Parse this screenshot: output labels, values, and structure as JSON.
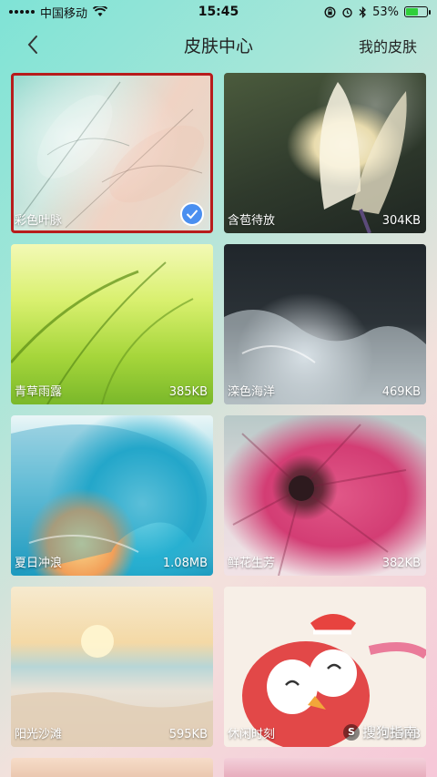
{
  "status_bar": {
    "carrier": "中国移动",
    "time": "15:45",
    "battery_percent": "53%",
    "battery_level": 0.53
  },
  "nav": {
    "title": "皮肤中心",
    "my_skins_label": "我的皮肤"
  },
  "skins": [
    {
      "name": "彩色叶脉",
      "size": "",
      "selected": true
    },
    {
      "name": "含苞待放",
      "size": "304KB"
    },
    {
      "name": "青草雨露",
      "size": "385KB"
    },
    {
      "name": "滦色海洋",
      "size": "469KB"
    },
    {
      "name": "夏日冲浪",
      "size": "1.08MB"
    },
    {
      "name": "鲜花生芳",
      "size": "382KB"
    },
    {
      "name": "阳光沙滩",
      "size": "595KB"
    },
    {
      "name": "休闲时刻",
      "size": "159KB"
    }
  ],
  "watermark": "搜狗指南",
  "colors": {
    "selected_border": "#b71c1c",
    "check_badge": "#4a8ff0"
  }
}
